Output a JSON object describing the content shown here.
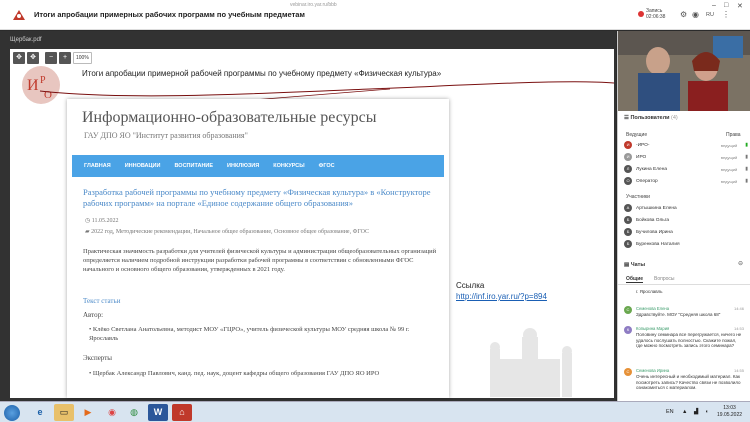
{
  "window": {
    "title": "Итоги апробации примерных рабочих программ по учебным предметам",
    "url_hint": "vebinar.iro.yar.ru/bbb",
    "recording_label": "Запись",
    "recording_time": "02:06:38",
    "lang": "RU"
  },
  "stage": {
    "doc_name": "Щербак.pdf",
    "zoom_value": "100%",
    "slide_title": "Итоги апробации примерной рабочей программы по учебному предмету «Физическая культура»",
    "page": {
      "header": "Информационно-образовательные ресурсы",
      "subheader": "ГАУ ДПО ЯО \"Институт развития образования\"",
      "nav": [
        "ГЛАВНАЯ",
        "ИННОВАЦИИ",
        "ВОСПИТАНИЕ",
        "ИНКЛЮЗИЯ",
        "КОНКУРСЫ",
        "ФГОС"
      ],
      "article_title": "Разработка рабочей программы по учебному предмету «Физическая культура» в «Конструкторе рабочих программ» на портале «Единое содержание общего образования»",
      "date": "11.05.2022",
      "tags": "2022 год, Методические рекомендации, Начальное общее образование, Основное общее образование, ФГОС",
      "body": "Практическая значимость разработки для учителей физической культуры и администрации общеобразовательных организаций определяется наличием подробной инструкции разработки рабочей программы в соответствии с обновленными ФГОС начального и основного общего образования, утвержденных в 2021 году.",
      "text_link": "Текст статьи",
      "author_label": "Автор:",
      "author": "Клёко Светлана Анатольевна, методист МОУ «ГЦРО», учитель физической культуры МОУ средняя школа № 99 г. Ярославль",
      "experts_label": "Эксперты",
      "expert": "Щербак Александр Павлович, канд. пед. наук, доцент кафедры общего образования ГАУ ДПО ЯО ИРО"
    },
    "link_label": "Ссылка",
    "link_url": "http://inf.iro.yar.ru/?p=894"
  },
  "panel": {
    "users_title": "Пользователи",
    "users_count": "(4)",
    "hosts_label": "Ведущие",
    "rights_label": "Права",
    "hosts": [
      {
        "name": "-ИРО-",
        "role": "ведущий"
      },
      {
        "name": "ИРО",
        "role": "ведущий"
      },
      {
        "name": "Лукина Елена",
        "role": "ведущий"
      },
      {
        "name": "Оператор",
        "role": "ведущий"
      }
    ],
    "participants_label": "Участники",
    "participants": [
      {
        "name": "Артышкина Елена"
      },
      {
        "name": "Бойкова Ольга"
      },
      {
        "name": "Бучилова Ирина"
      },
      {
        "name": "Буренкова Наталия"
      }
    ],
    "chat_title": "Чаты",
    "chat_tabs": [
      "Общие",
      "Вопросы"
    ],
    "messages": [
      {
        "name": "",
        "time": "",
        "text": "г. Ярославль"
      },
      {
        "name": "Семенова Елена",
        "time": "14:46",
        "text": "Здравствуйте. МОУ \"Средняя школа 68\""
      },
      {
        "name": "Копырина Мария",
        "time": "14:53",
        "text": "Половину семинара все перегружается, ничего не удалось послушать полностью. Скажите пожал, где можно посмотреть запись этого семинара?"
      },
      {
        "name": "Семенова Ирина",
        "time": "14:55",
        "text": "Очень интересный и необходимый материал. Как посмотреть запись? Качество связи не позволило ознакомиться с материалом."
      }
    ]
  },
  "taskbar": {
    "lang": "EN",
    "time": "13:03",
    "date": "19.05.2022"
  }
}
